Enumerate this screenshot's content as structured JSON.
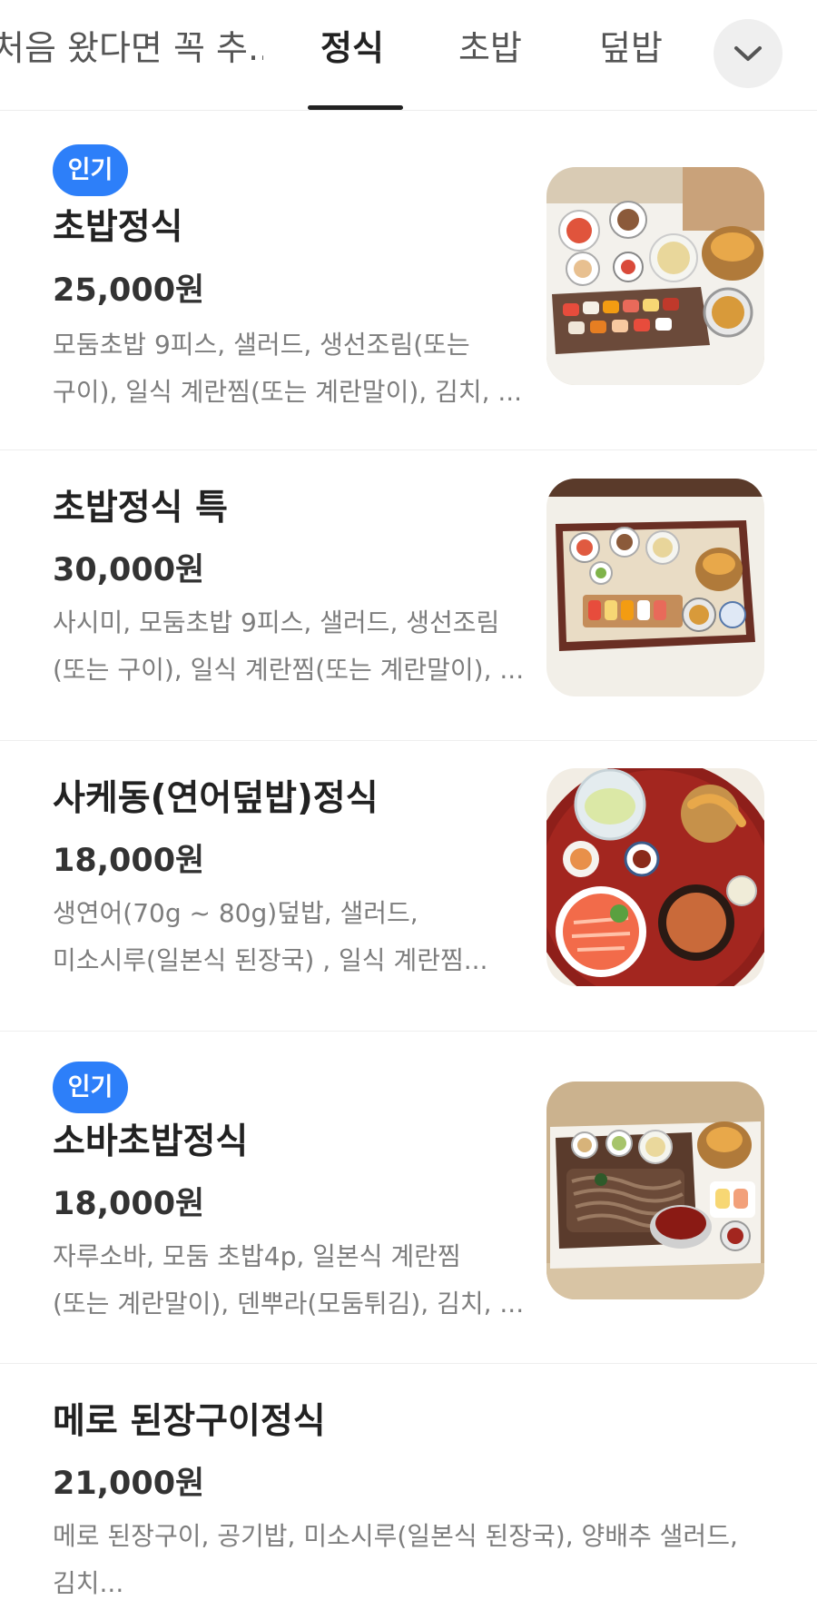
{
  "tabs": [
    {
      "label": "처음 왔다면 꼭 추...",
      "active": false
    },
    {
      "label": "정식",
      "active": true
    },
    {
      "label": "초밥",
      "active": false
    },
    {
      "label": "덮밥",
      "active": false
    }
  ],
  "more_icon": "chevron-down-icon",
  "menu": [
    {
      "badge": "인기",
      "name": "초밥정식",
      "price": "25,000원",
      "description": "모둠초밥 9피스, 샐러드, 생선조림(또는\n구이), 일식 계란찜(또는 계란말이), 김치, ...",
      "image": "sushi-set-photo"
    },
    {
      "badge": "",
      "name": "초밥정식 특",
      "price": "30,000원",
      "description": "사시미, 모둠초밥 9피스, 샐러드, 생선조림\n(또는 구이), 일식 계란찜(또는 계란말이), ...",
      "image": "special-sushi-set-photo"
    },
    {
      "badge": "",
      "name": "사케동(연어덮밥)정식",
      "price": "18,000원",
      "description": "생연어(70g ~ 80g)덮밥, 샐러드,\n미소시루(일본식 된장국) , 일식 계란찜...",
      "image": "salmon-bowl-set-photo"
    },
    {
      "badge": "인기",
      "name": "소바초밥정식",
      "price": "18,000원",
      "description": "자루소바, 모둠 초밥4p, 일본식 계란찜\n(또는 계란말이), 덴뿌라(모둠튀김), 김치, ...",
      "image": "soba-sushi-set-photo"
    },
    {
      "badge": "",
      "name": "메로 된장구이정식",
      "price": "21,000원",
      "description": "메로 된장구이, 공기밥, 미소시루(일본식 된장국), 양배추 샐러드,\n김치...",
      "image": ""
    }
  ],
  "colors": {
    "badge_bg": "#2d7ff9",
    "active_tab": "#222222",
    "inactive_tab": "#555555",
    "description": "#7d7d7d"
  }
}
